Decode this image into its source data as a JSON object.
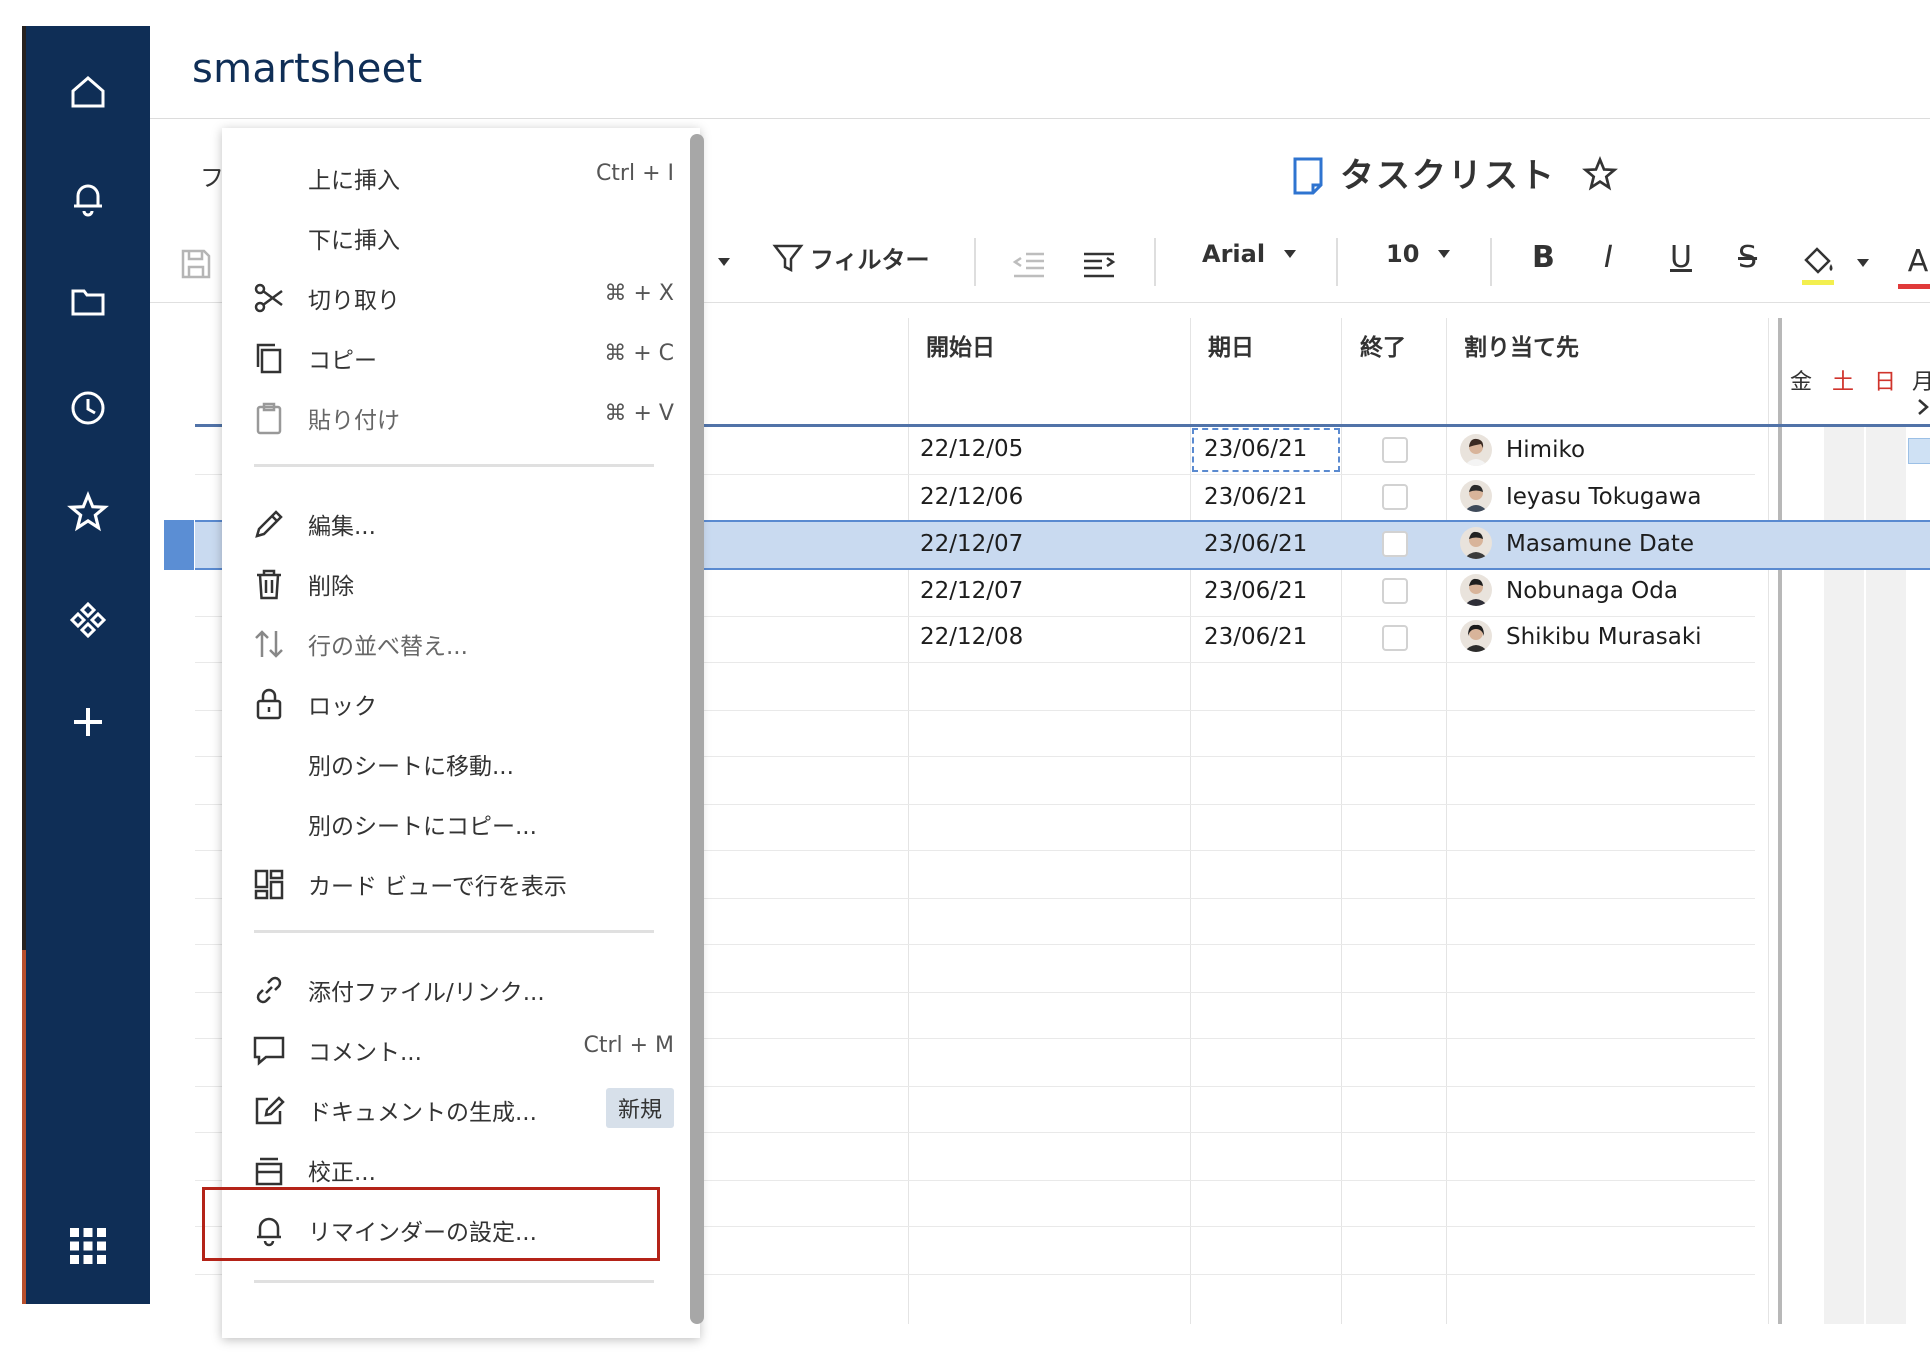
{
  "app": {
    "logo": "smartsheet"
  },
  "sheet": {
    "title": "タスクリスト"
  },
  "toolbar": {
    "partial_left": "フ",
    "filter_label": "フィルター",
    "font_name": "Arial",
    "font_size": "10",
    "bold": "B",
    "italic": "I",
    "underline": "U",
    "strike": "S",
    "text_color_glyph": "A",
    "fill_color": "#f3ef4f",
    "text_color": "#e03a3a"
  },
  "grid": {
    "columns": [
      "開始日",
      "期日",
      "終了",
      "割り当て先"
    ],
    "gantt_days": [
      "金",
      "土",
      "日",
      "月"
    ],
    "gantt_weekend_color": "#d0342c",
    "rows": [
      {
        "start": "22/12/05",
        "due": "23/06/21",
        "done": false,
        "assignee": "Himiko"
      },
      {
        "start": "22/12/06",
        "due": "23/06/21",
        "done": false,
        "assignee": "Ieyasu Tokugawa"
      },
      {
        "start": "22/12/07",
        "due": "23/06/21",
        "done": false,
        "assignee": "Masamune Date"
      },
      {
        "start": "22/12/07",
        "due": "23/06/21",
        "done": false,
        "assignee": "Nobunaga Oda"
      },
      {
        "start": "22/12/08",
        "due": "23/06/21",
        "done": false,
        "assignee": "Shikibu Murasaki"
      }
    ],
    "selected_row_color": "#c9daf0"
  },
  "menu": {
    "insert_above": {
      "label": "上に挿入",
      "shortcut": "Ctrl + I"
    },
    "insert_below": {
      "label": "下に挿入"
    },
    "cut": {
      "label": "切り取り",
      "shortcut": "⌘ + X"
    },
    "copy": {
      "label": "コピー",
      "shortcut": "⌘ + C"
    },
    "paste": {
      "label": "貼り付け",
      "shortcut": "⌘ + V"
    },
    "edit": {
      "label": "編集..."
    },
    "delete": {
      "label": "削除"
    },
    "sort": {
      "label": "行の並べ替え..."
    },
    "lock": {
      "label": "ロック"
    },
    "move_to_sheet": {
      "label": "別のシートに移動..."
    },
    "copy_to_sheet": {
      "label": "別のシートにコピー..."
    },
    "card_view": {
      "label": "カード ビューで行を表示"
    },
    "attachments": {
      "label": "添付ファイル/リンク..."
    },
    "comment": {
      "label": "コメント...",
      "shortcut": "Ctrl + M"
    },
    "generate_doc": {
      "label": "ドキュメントの生成...",
      "badge": "新規"
    },
    "proof": {
      "label": "校正..."
    },
    "reminder": {
      "label": "リマインダーの設定..."
    },
    "highlight_color": "#b42318"
  }
}
